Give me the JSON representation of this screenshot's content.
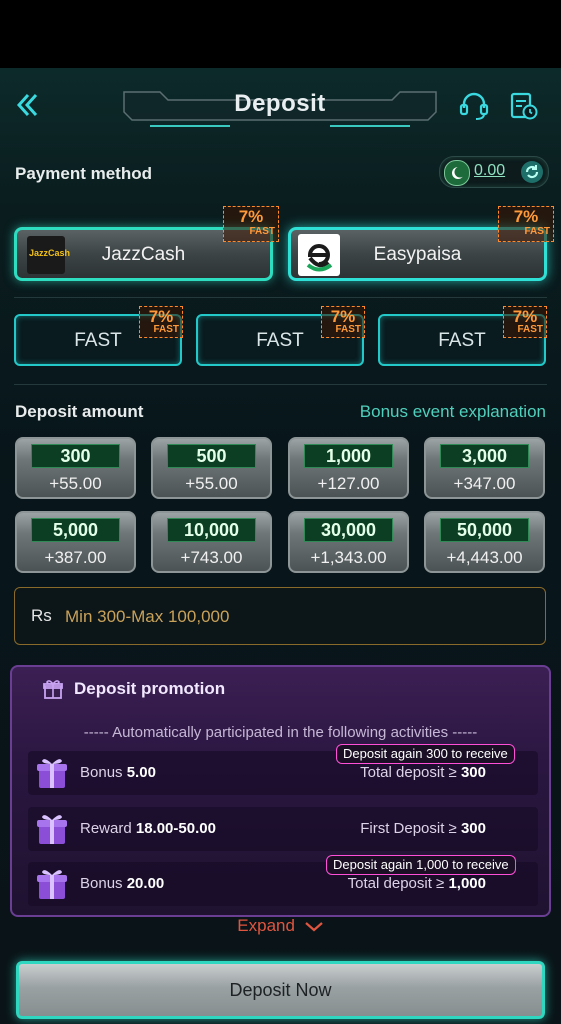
{
  "header": {
    "title": "Deposit",
    "back_icon": "chevron-left-icon",
    "support_icon": "headset-icon",
    "history_icon": "record-history-icon"
  },
  "payment": {
    "label": "Payment method",
    "balance": "0.00",
    "methods": [
      {
        "name": "JazzCash",
        "logo_text": "JazzCash",
        "badge_pct": "7%",
        "badge_fast": "FAST"
      },
      {
        "name": "Easypaisa",
        "badge_pct": "7%",
        "badge_fast": "FAST"
      }
    ],
    "fast_channels": [
      {
        "label": "FAST",
        "badge_pct": "7%",
        "badge_fast": "FAST"
      },
      {
        "label": "FAST",
        "badge_pct": "7%",
        "badge_fast": "FAST"
      },
      {
        "label": "FAST",
        "badge_pct": "7%",
        "badge_fast": "FAST"
      }
    ]
  },
  "amount": {
    "label": "Deposit amount",
    "bonus_link": "Bonus event explanation",
    "options": [
      {
        "amount": "300",
        "bonus": "+55.00"
      },
      {
        "amount": "500",
        "bonus": "+55.00"
      },
      {
        "amount": "1,000",
        "bonus": "+127.00"
      },
      {
        "amount": "3,000",
        "bonus": "+347.00"
      },
      {
        "amount": "5,000",
        "bonus": "+387.00"
      },
      {
        "amount": "10,000",
        "bonus": "+743.00"
      },
      {
        "amount": "30,000",
        "bonus": "+1,343.00"
      },
      {
        "amount": "50,000",
        "bonus": "+4,443.00"
      }
    ],
    "currency": "Rs",
    "placeholder": "Min 300-Max 100,000"
  },
  "promotion": {
    "title": "Deposit promotion",
    "subtitle": "----- Automatically participated in the following activities -----",
    "rows": [
      {
        "label": "Bonus",
        "value": "5.00",
        "condition": "Total deposit ≥",
        "condition_value": "300",
        "tip": "Deposit again 300 to receive"
      },
      {
        "label": "Reward",
        "value": "18.00-50.00",
        "condition": "First Deposit ≥",
        "condition_value": "300",
        "tip": ""
      },
      {
        "label": "Bonus",
        "value": "20.00",
        "condition": "Total deposit ≥",
        "condition_value": "1,000",
        "tip": "Deposit again 1,000 to receive"
      }
    ],
    "expand": "Expand"
  },
  "deposit_button": "Deposit Now",
  "colors": {
    "accent": "#2fd6c0",
    "badge": "#ff9a3a",
    "promo": "#3c1f54",
    "expand": "#e0553f"
  }
}
